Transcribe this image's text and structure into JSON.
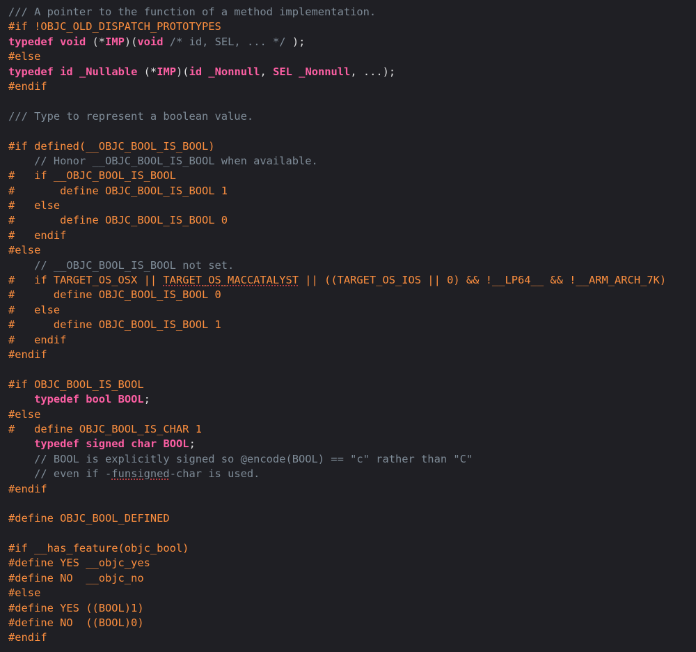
{
  "colors": {
    "background": "#1f1f24",
    "plain": "#dfdfe0",
    "preprocessor": "#fd8f3f",
    "comment": "#7f8c98",
    "keyword": "#fc5fa3",
    "spelling_underline": "#e5484d"
  },
  "lines": [
    [
      [
        "comment",
        "/// A pointer to the function of a method implementation."
      ]
    ],
    [
      [
        "pp",
        "#if !OBJC_OLD_DISPATCH_PROTOTYPES"
      ]
    ],
    [
      [
        "keyword",
        "typedef"
      ],
      [
        "plain",
        " "
      ],
      [
        "keyword",
        "void"
      ],
      [
        "plain",
        " (*"
      ],
      [
        "keyword",
        "IMP"
      ],
      [
        "plain",
        ")("
      ],
      [
        "keyword",
        "void"
      ],
      [
        "plain",
        " "
      ],
      [
        "comment",
        "/* id, SEL, ... */"
      ],
      [
        "plain",
        " );"
      ]
    ],
    [
      [
        "pp",
        "#else"
      ]
    ],
    [
      [
        "keyword",
        "typedef"
      ],
      [
        "plain",
        " "
      ],
      [
        "keyword",
        "id"
      ],
      [
        "plain",
        " "
      ],
      [
        "keyword",
        "_Nullable"
      ],
      [
        "plain",
        " (*"
      ],
      [
        "keyword",
        "IMP"
      ],
      [
        "plain",
        ")("
      ],
      [
        "keyword",
        "id"
      ],
      [
        "plain",
        " "
      ],
      [
        "keyword",
        "_Nonnull"
      ],
      [
        "plain",
        ", "
      ],
      [
        "keyword",
        "SEL"
      ],
      [
        "plain",
        " "
      ],
      [
        "keyword",
        "_Nonnull"
      ],
      [
        "plain",
        ", ...);"
      ]
    ],
    [
      [
        "pp",
        "#endif"
      ]
    ],
    [],
    [
      [
        "comment",
        "/// Type to represent a boolean value."
      ]
    ],
    [],
    [
      [
        "pp",
        "#if defined(__OBJC_BOOL_IS_BOOL)"
      ]
    ],
    [
      [
        "plain",
        "    "
      ],
      [
        "comment",
        "// Honor __OBJC_BOOL_IS_BOOL when available."
      ]
    ],
    [
      [
        "pp",
        "#   if __OBJC_BOOL_IS_BOOL"
      ]
    ],
    [
      [
        "pp",
        "#       define OBJC_BOOL_IS_BOOL 1"
      ]
    ],
    [
      [
        "pp",
        "#   else"
      ]
    ],
    [
      [
        "pp",
        "#       define OBJC_BOOL_IS_BOOL 0"
      ]
    ],
    [
      [
        "pp",
        "#   endif"
      ]
    ],
    [
      [
        "pp",
        "#else"
      ]
    ],
    [
      [
        "plain",
        "    "
      ],
      [
        "comment",
        "// __OBJC_BOOL_IS_BOOL not set."
      ]
    ],
    [
      [
        "pp",
        "#   if TARGET_OS_OSX || "
      ],
      [
        "pp-spell",
        "TARGET_OS_MACCATALYST"
      ],
      [
        "pp",
        " || ((TARGET_OS_IOS || 0) && !__LP64__ && !__ARM_ARCH_7K)"
      ]
    ],
    [
      [
        "pp",
        "#      define OBJC_BOOL_IS_BOOL 0"
      ]
    ],
    [
      [
        "pp",
        "#   else"
      ]
    ],
    [
      [
        "pp",
        "#      define OBJC_BOOL_IS_BOOL 1"
      ]
    ],
    [
      [
        "pp",
        "#   endif"
      ]
    ],
    [
      [
        "pp",
        "#endif"
      ]
    ],
    [],
    [
      [
        "pp",
        "#if OBJC_BOOL_IS_BOOL"
      ]
    ],
    [
      [
        "plain",
        "    "
      ],
      [
        "keyword",
        "typedef"
      ],
      [
        "plain",
        " "
      ],
      [
        "keyword",
        "bool"
      ],
      [
        "plain",
        " "
      ],
      [
        "keyword",
        "BOOL"
      ],
      [
        "plain",
        ";"
      ]
    ],
    [
      [
        "pp",
        "#else"
      ]
    ],
    [
      [
        "pp",
        "#   define OBJC_BOOL_IS_CHAR 1"
      ]
    ],
    [
      [
        "plain",
        "    "
      ],
      [
        "keyword",
        "typedef"
      ],
      [
        "plain",
        " "
      ],
      [
        "keyword",
        "signed"
      ],
      [
        "plain",
        " "
      ],
      [
        "keyword",
        "char"
      ],
      [
        "plain",
        " "
      ],
      [
        "keyword",
        "BOOL"
      ],
      [
        "plain",
        ";"
      ]
    ],
    [
      [
        "plain",
        "    "
      ],
      [
        "comment",
        "// BOOL is explicitly signed so @encode(BOOL) == \"c\" rather than \"C\""
      ]
    ],
    [
      [
        "plain",
        "    "
      ],
      [
        "comment",
        "// even if -"
      ],
      [
        "comment-spell",
        "funsigned"
      ],
      [
        "comment",
        "-char is used."
      ]
    ],
    [
      [
        "pp",
        "#endif"
      ]
    ],
    [],
    [
      [
        "pp",
        "#define OBJC_BOOL_DEFINED"
      ]
    ],
    [],
    [
      [
        "pp",
        "#if __has_feature(objc_bool)"
      ]
    ],
    [
      [
        "pp",
        "#define YES __objc_yes"
      ]
    ],
    [
      [
        "pp",
        "#define NO  __objc_no"
      ]
    ],
    [
      [
        "pp",
        "#else"
      ]
    ],
    [
      [
        "pp",
        "#define YES ((BOOL)1)"
      ]
    ],
    [
      [
        "pp",
        "#define NO  ((BOOL)0)"
      ]
    ],
    [
      [
        "pp",
        "#endif"
      ]
    ]
  ]
}
